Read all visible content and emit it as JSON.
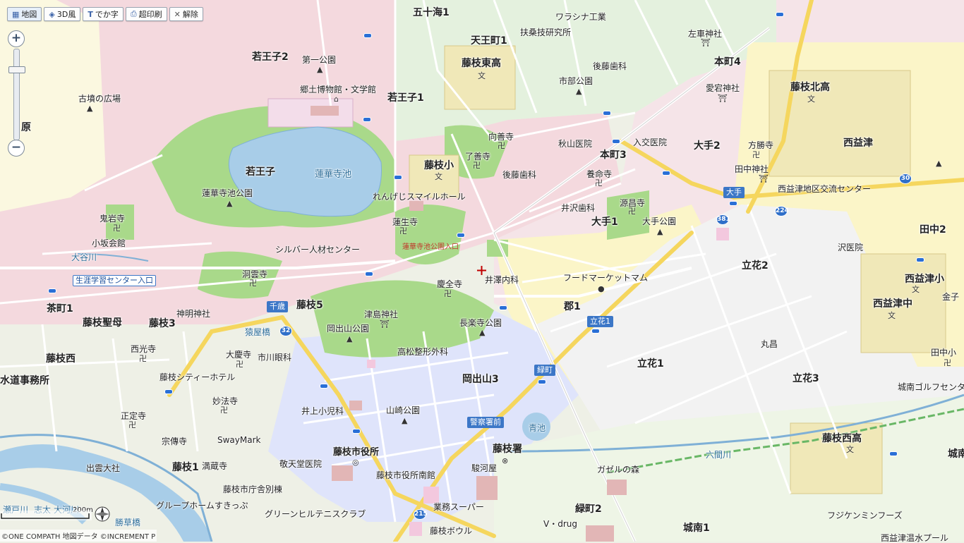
{
  "toolbar": [
    {
      "label": "地図",
      "icon": "map-icon"
    },
    {
      "label": "3D風",
      "icon": "3d-icon"
    },
    {
      "label": "でか字",
      "icon": "large-text-icon"
    },
    {
      "label": "超印刷",
      "icon": "print-icon"
    },
    {
      "label": "解除",
      "icon": "close-icon"
    }
  ],
  "zoom": {
    "plus": "+",
    "minus": "−"
  },
  "scale": "200m",
  "credit": "©ONE COMPATH 地図データ ©INCREMENT P",
  "areas": [
    "五十海1",
    "天王町1",
    "若王子2",
    "若王子1",
    "若王子",
    "本町4",
    "藤枝北高",
    "藤枝東高",
    "大手2",
    "本町3",
    "西益津",
    "藤枝小",
    "大手1",
    "田中2",
    "立花2",
    "西益津小",
    "西益津中",
    "藤枝5",
    "郡1",
    "茶町1",
    "藤枝聖母",
    "藤枝3",
    "藤枝西",
    "岡出山3",
    "立花1",
    "立花3",
    "水道事務所",
    "藤枝1",
    "藤枝署",
    "藤枝西高",
    "緑町2",
    "城南1",
    "城南",
    "原",
    "金子"
  ],
  "pois": [
    "ワラシナ工業",
    "扶桑技研究所",
    "左車神社",
    "第一公園",
    "市部公園",
    "後藤歯科",
    "郷土博物館・文学館",
    "愛宕神社",
    "古墳の広場",
    "蓮華寺池公園",
    "向善寺",
    "入交医院",
    "秋山医院",
    "了善寺",
    "方勝寺",
    "田中神社",
    "後藤歯科",
    "養命寺",
    "西益津地区交流センター",
    "れんげじスマイルホール",
    "源昌寺",
    "井沢歯科",
    "鬼岩寺",
    "小坂会館",
    "蓮生寺",
    "大手公園",
    "シルバー人材センター",
    "沢医院",
    "洞雲寺",
    "井澤内科",
    "フードマーケットマム",
    "慶全寺",
    "生涯学習センター入口",
    "神明神社",
    "津島神社",
    "岡出山公園",
    "長楽寺公園",
    "丸昌",
    "西光寺",
    "大慶寺",
    "藤枝シティーホテル",
    "市川眼科",
    "高松整形外科",
    "田中小",
    "妙法寺",
    "城南ゴルフセンター",
    "井上小児科",
    "山崎公園",
    "正定寺",
    "SwayMark",
    "宗傳寺",
    "藤枝市役所",
    "出雲大社",
    "満蔵寺",
    "敬天堂医院",
    "駿河屋",
    "ガゼルの森",
    "藤枝市庁舎別棟",
    "藤枝市役所南館",
    "業務スーパー",
    "グループホームすきっぷ",
    "グリーンヒルテニスクラブ",
    "V・drug",
    "フジケンミンフーズ",
    "藤枝ボウル",
    "西益津温水プール"
  ],
  "waters": [
    "蓮華寺池",
    "大谷川",
    "青池",
    "六間川",
    "瀬戸川",
    "志太",
    "大河川",
    "勝草橋",
    "猿屋橋"
  ],
  "stops": [
    "蓮華寺池公園入口",
    "千歳",
    "立花1",
    "緑町",
    "警察署前",
    "大手"
  ],
  "routes": [
    "381",
    "224",
    "30",
    "32",
    "215"
  ],
  "colors": {
    "residential_pink": "#f4d9de",
    "commercial_yellow": "#fbf5c8",
    "green_res": "#e4f1de",
    "park": "#a9d98a",
    "water": "#a8cde8",
    "school": "#f0e8b8",
    "road": "#ffffff",
    "major_road": "#fde89a",
    "official": "#d8defa"
  }
}
